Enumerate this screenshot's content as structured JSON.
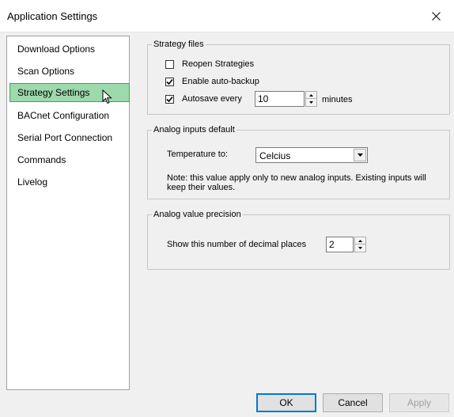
{
  "window": {
    "title": "Application Settings"
  },
  "nav": {
    "items": [
      {
        "label": "Download Options"
      },
      {
        "label": "Scan Options"
      },
      {
        "label": "Strategy Settings"
      },
      {
        "label": "BACnet Configuration"
      },
      {
        "label": "Serial Port Connection"
      },
      {
        "label": "Commands"
      },
      {
        "label": "Livelog"
      }
    ],
    "selected": "Strategy Settings",
    "selected_color": "#9cd9ab"
  },
  "strategy_files": {
    "title": "Strategy files",
    "reopen": {
      "label": "Reopen Strategies",
      "checked": false
    },
    "auto_backup": {
      "label": "Enable auto-backup",
      "checked": true
    },
    "autosave": {
      "label": "Autosave every",
      "checked": true,
      "value": "10",
      "unit": "minutes"
    }
  },
  "analog_inputs": {
    "title": "Analog inputs default",
    "temperature_label": "Temperature to:",
    "temperature_value": "Celcius",
    "note": "Note: this value apply only to new analog inputs. Existing inputs will keep their values."
  },
  "analog_precision": {
    "title": "Analog value precision",
    "decimal_label": "Show this number of decimal places",
    "decimal_value": "2"
  },
  "buttons": {
    "ok": "OK",
    "cancel": "Cancel",
    "apply": "Apply"
  }
}
